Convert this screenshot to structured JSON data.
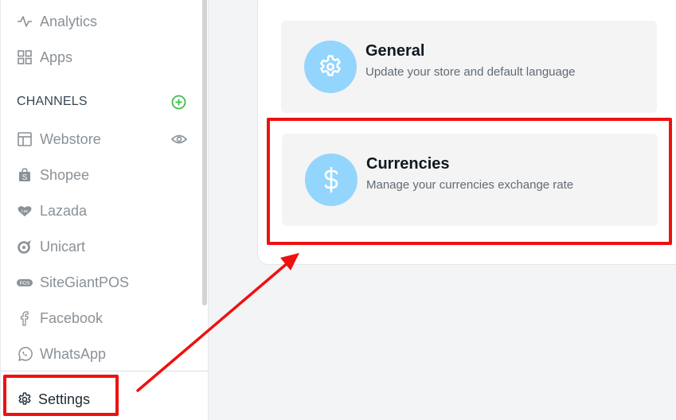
{
  "sidebar": {
    "items": [
      {
        "label": "Analytics",
        "icon": "analytics-pulse-icon"
      },
      {
        "label": "Apps",
        "icon": "apps-grid-icon"
      }
    ],
    "channels_section": {
      "label": "CHANNELS",
      "add_icon": "plus-circle-icon",
      "add_color": "#3fbf4f",
      "items": [
        {
          "label": "Webstore",
          "icon": "webstore-layout-icon",
          "action_icon": "eye-icon"
        },
        {
          "label": "Shopee",
          "icon": "shopee-bag-icon"
        },
        {
          "label": "Lazada",
          "icon": "lazada-heart-icon"
        },
        {
          "label": "Unicart",
          "icon": "unicart-icon"
        },
        {
          "label": "SiteGiantPOS",
          "icon": "pos-badge-icon"
        },
        {
          "label": "Facebook",
          "icon": "facebook-icon"
        },
        {
          "label": "WhatsApp",
          "icon": "whatsapp-icon"
        }
      ]
    },
    "settings": {
      "label": "Settings",
      "icon": "gear-icon"
    }
  },
  "main": {
    "cards": [
      {
        "title": "General",
        "description": "Update your store and default language",
        "icon": "gear-icon"
      },
      {
        "title": "Currencies",
        "description": "Manage your currencies exchange rate",
        "icon": "dollar-icon"
      }
    ],
    "icon_circle_color": "#93d5fd"
  },
  "annotations": {
    "color": "#ee1111",
    "highlighted": [
      "Settings",
      "Currencies"
    ],
    "arrow": "from Settings to Currencies"
  }
}
